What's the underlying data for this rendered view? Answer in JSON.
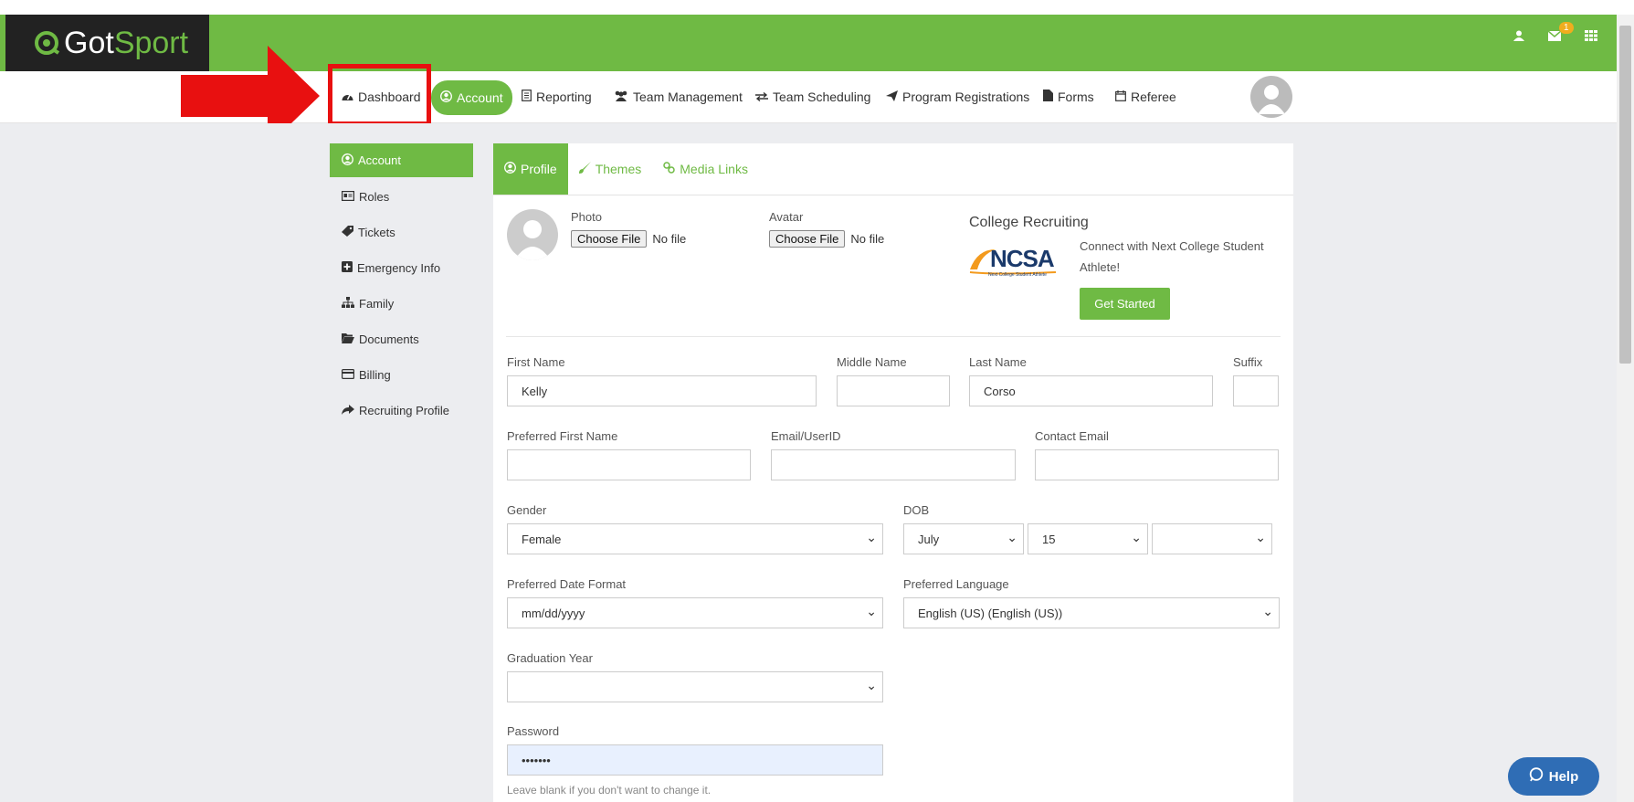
{
  "app": {
    "logo_got": "Got",
    "logo_sport": "Sport"
  },
  "topbar": {
    "mail_badge": "1",
    "icons": [
      "user-icon",
      "mail-icon",
      "grid-icon"
    ]
  },
  "nav": {
    "items": [
      {
        "label": "Dashboard",
        "icon": "dashboard-icon"
      },
      {
        "label": "Account",
        "icon": "user-circle-icon"
      },
      {
        "label": "Reporting",
        "icon": "file-icon"
      },
      {
        "label": "Team Management",
        "icon": "users-icon"
      },
      {
        "label": "Team Scheduling",
        "icon": "exchange-icon"
      },
      {
        "label": "Program Registrations",
        "icon": "send-icon"
      },
      {
        "label": "Forms",
        "icon": "document-icon"
      },
      {
        "label": "Referee",
        "icon": "calendar-icon"
      }
    ]
  },
  "sidebar": {
    "items": [
      {
        "label": "Account",
        "icon": "user-circle-icon"
      },
      {
        "label": "Roles",
        "icon": "id-card-icon"
      },
      {
        "label": "Tickets",
        "icon": "ticket-icon"
      },
      {
        "label": "Emergency Info",
        "icon": "plus-square-icon"
      },
      {
        "label": "Family",
        "icon": "sitemap-icon"
      },
      {
        "label": "Documents",
        "icon": "folder-open-icon"
      },
      {
        "label": "Billing",
        "icon": "credit-card-icon"
      },
      {
        "label": "Recruiting Profile",
        "icon": "share-icon"
      }
    ]
  },
  "tabs": [
    {
      "label": "Profile",
      "icon": "user-circle-icon"
    },
    {
      "label": "Themes",
      "icon": "brush-icon"
    },
    {
      "label": "Media Links",
      "icon": "link-icon"
    }
  ],
  "profile": {
    "photo_label": "Photo",
    "avatar_label": "Avatar",
    "choose_file": "Choose File",
    "no_file": "No file",
    "college_title": "College Recruiting",
    "ncsa_logo": "NCSA",
    "ncsa_tagline": "Next College Student Athlete",
    "connect_text_1": "Connect with Next College Student",
    "connect_text_2": "Athlete!",
    "get_started": "Get Started"
  },
  "form": {
    "first_name_label": "First Name",
    "first_name_value": "Kelly",
    "middle_name_label": "Middle Name",
    "middle_name_value": "",
    "last_name_label": "Last Name",
    "last_name_value": "Corso",
    "suffix_label": "Suffix",
    "suffix_value": "",
    "preferred_first_label": "Preferred First Name",
    "preferred_first_value": "",
    "email_label": "Email/UserID",
    "email_value": "",
    "contact_email_label": "Contact Email",
    "contact_email_value": "",
    "gender_label": "Gender",
    "gender_value": "Female",
    "dob_label": "DOB",
    "dob_month": "July",
    "dob_day": "15",
    "dob_year": "",
    "date_format_label": "Preferred Date Format",
    "date_format_value": "mm/dd/yyyy",
    "language_label": "Preferred Language",
    "language_value": "English (US) (English (US))",
    "grad_year_label": "Graduation Year",
    "grad_year_value": "",
    "password_label": "Password",
    "password_value": "•••••••",
    "password_hint": "Leave blank if you don't want to change it."
  },
  "help": {
    "label": "Help"
  },
  "colors": {
    "brand_green": "#6fba44",
    "annotation_red": "#e81010",
    "help_blue": "#2f6db5"
  }
}
